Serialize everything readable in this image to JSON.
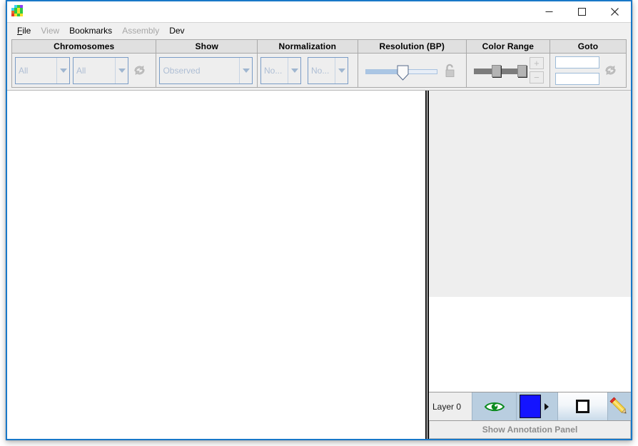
{
  "window": {
    "app_icon": "juicebox-logo-icon",
    "icon_colors": [
      "#ffffff",
      "#3ad2f0",
      "#2ecc40",
      "#8b3df5",
      "#3ad2f0",
      "#2ecc40",
      "#f5e02a",
      "#2ecc40",
      "#e86a2a",
      "#2ecc40",
      "#f5e02a",
      "#2ecc40",
      "#e83a2a",
      "#f5e02a",
      "#2ecc40",
      "#f5e02a"
    ],
    "minimize_label": "minimize-icon",
    "maximize_label": "maximize-icon",
    "close_label": "close-icon",
    "border_color": "#1878c8"
  },
  "menubar": {
    "items": [
      {
        "label": "File",
        "mnemonic": "F",
        "disabled": false
      },
      {
        "label": "View",
        "mnemonic": "",
        "disabled": true
      },
      {
        "label": "Bookmarks",
        "mnemonic": "",
        "disabled": false
      },
      {
        "label": "Assembly",
        "mnemonic": "",
        "disabled": true
      },
      {
        "label": "Dev",
        "mnemonic": "",
        "disabled": false
      }
    ]
  },
  "toolbar": {
    "chromosomes": {
      "title": "Chromosomes",
      "combo_x_value": "All",
      "combo_y_value": "All",
      "refresh_icon": "refresh-icon"
    },
    "show": {
      "title": "Show",
      "combo_value": "Observed"
    },
    "normalization": {
      "title": "Normalization",
      "combo_row_value": "No...",
      "combo_col_value": "No..."
    },
    "resolution": {
      "title": "Resolution (BP)",
      "slider_percent": 52,
      "lock_icon": "unlock-icon",
      "locked": false
    },
    "color_range": {
      "title": "Color Range",
      "min_handle_percent": 43,
      "max_handle_percent": 90,
      "plus_label": "+",
      "minus_label": "−"
    },
    "goto": {
      "title": "Goto",
      "field_1_value": "",
      "field_2_value": "",
      "field_1_placeholder": "",
      "field_2_placeholder": "",
      "refresh_icon": "refresh-icon"
    }
  },
  "main": {
    "heatmap_background": "#ffffff",
    "right_top_background": "#eeeeee",
    "divider_color": "#111111"
  },
  "annotation_bar": {
    "layer_label": "Layer 0",
    "eye_icon": "eye-visible-icon",
    "eye_color": "#0b8a1f",
    "color_swatch": "#1414ff",
    "color_dropdown_icon": "caret-right-icon",
    "square_icon": "square-outline-icon",
    "pencil_icon": "pencil-edit-icon",
    "footer_label": "Show Annotation Panel"
  }
}
